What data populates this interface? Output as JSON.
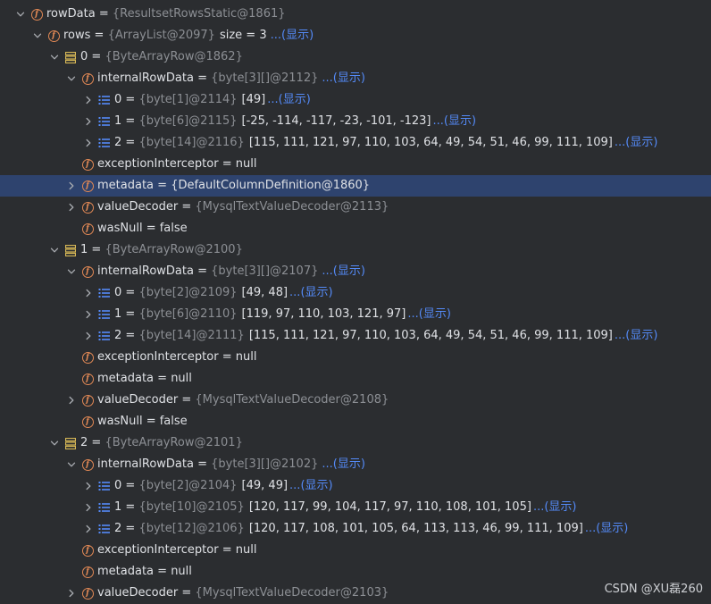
{
  "link_label": "...(显示)",
  "watermark": "CSDN @XU磊260",
  "colors": {
    "background": "#2b2d30",
    "selection": "#2e436e",
    "field_icon": "#e08855",
    "array_icon": "#548af7",
    "row_icon": "#d6b756",
    "reference_text": "#8c8f94",
    "link": "#548af7"
  },
  "rows": [
    {
      "level": 0,
      "arrow": "expanded",
      "icon": "field-icon",
      "name": "rowData",
      "ref": "{ResultsetRowsStatic@1861}",
      "value": "",
      "extra": "",
      "link": false,
      "selected": false
    },
    {
      "level": 1,
      "arrow": "expanded",
      "icon": "field-icon",
      "name": "rows",
      "ref": "{ArrayList@2097}",
      "value": "",
      "extra": "size = 3",
      "link": true,
      "selected": false
    },
    {
      "level": 2,
      "arrow": "expanded",
      "icon": "row-icon",
      "name": "0",
      "ref": "{ByteArrayRow@1862}",
      "value": "",
      "extra": "",
      "link": false,
      "selected": false
    },
    {
      "level": 3,
      "arrow": "expanded",
      "icon": "field-icon",
      "name": "internalRowData",
      "ref": "{byte[3][]@2112}",
      "value": "",
      "extra": "",
      "link": true,
      "selected": false
    },
    {
      "level": 4,
      "arrow": "collapsed",
      "icon": "array-icon",
      "name": "0",
      "ref": "{byte[1]@2114}",
      "value": "[49]",
      "extra": "",
      "link": true,
      "selected": false
    },
    {
      "level": 4,
      "arrow": "collapsed",
      "icon": "array-icon",
      "name": "1",
      "ref": "{byte[6]@2115}",
      "value": "[-25, -114, -117, -23, -101, -123]",
      "extra": "",
      "link": true,
      "selected": false
    },
    {
      "level": 4,
      "arrow": "collapsed",
      "icon": "array-icon",
      "name": "2",
      "ref": "{byte[14]@2116}",
      "value": "[115, 111, 121, 97, 110, 103, 64, 49, 54, 51, 46, 99, 111, 109]",
      "extra": "",
      "link": true,
      "selected": false
    },
    {
      "level": 3,
      "arrow": "none",
      "icon": "field-icon",
      "name": "exceptionInterceptor",
      "ref": "",
      "value": "null",
      "extra": "",
      "link": false,
      "selected": false
    },
    {
      "level": 3,
      "arrow": "collapsed",
      "icon": "field-icon",
      "name": "metadata",
      "ref": "",
      "value": "{DefaultColumnDefinition@1860}",
      "extra": "",
      "link": false,
      "selected": true
    },
    {
      "level": 3,
      "arrow": "collapsed",
      "icon": "field-icon",
      "name": "valueDecoder",
      "ref": "{MysqlTextValueDecoder@2113}",
      "value": "",
      "extra": "",
      "link": false,
      "selected": false
    },
    {
      "level": 3,
      "arrow": "none",
      "icon": "field-icon",
      "name": "wasNull",
      "ref": "",
      "value": "false",
      "extra": "",
      "link": false,
      "selected": false
    },
    {
      "level": 2,
      "arrow": "expanded",
      "icon": "row-icon",
      "name": "1",
      "ref": "{ByteArrayRow@2100}",
      "value": "",
      "extra": "",
      "link": false,
      "selected": false
    },
    {
      "level": 3,
      "arrow": "expanded",
      "icon": "field-icon",
      "name": "internalRowData",
      "ref": "{byte[3][]@2107}",
      "value": "",
      "extra": "",
      "link": true,
      "selected": false
    },
    {
      "level": 4,
      "arrow": "collapsed",
      "icon": "array-icon",
      "name": "0",
      "ref": "{byte[2]@2109}",
      "value": "[49, 48]",
      "extra": "",
      "link": true,
      "selected": false
    },
    {
      "level": 4,
      "arrow": "collapsed",
      "icon": "array-icon",
      "name": "1",
      "ref": "{byte[6]@2110}",
      "value": "[119, 97, 110, 103, 121, 97]",
      "extra": "",
      "link": true,
      "selected": false
    },
    {
      "level": 4,
      "arrow": "collapsed",
      "icon": "array-icon",
      "name": "2",
      "ref": "{byte[14]@2111}",
      "value": "[115, 111, 121, 97, 110, 103, 64, 49, 54, 51, 46, 99, 111, 109]",
      "extra": "",
      "link": true,
      "selected": false
    },
    {
      "level": 3,
      "arrow": "none",
      "icon": "field-icon",
      "name": "exceptionInterceptor",
      "ref": "",
      "value": "null",
      "extra": "",
      "link": false,
      "selected": false
    },
    {
      "level": 3,
      "arrow": "none",
      "icon": "field-icon",
      "name": "metadata",
      "ref": "",
      "value": "null",
      "extra": "",
      "link": false,
      "selected": false
    },
    {
      "level": 3,
      "arrow": "collapsed",
      "icon": "field-icon",
      "name": "valueDecoder",
      "ref": "{MysqlTextValueDecoder@2108}",
      "value": "",
      "extra": "",
      "link": false,
      "selected": false
    },
    {
      "level": 3,
      "arrow": "none",
      "icon": "field-icon",
      "name": "wasNull",
      "ref": "",
      "value": "false",
      "extra": "",
      "link": false,
      "selected": false
    },
    {
      "level": 2,
      "arrow": "expanded",
      "icon": "row-icon",
      "name": "2",
      "ref": "{ByteArrayRow@2101}",
      "value": "",
      "extra": "",
      "link": false,
      "selected": false
    },
    {
      "level": 3,
      "arrow": "expanded",
      "icon": "field-icon",
      "name": "internalRowData",
      "ref": "{byte[3][]@2102}",
      "value": "",
      "extra": "",
      "link": true,
      "selected": false
    },
    {
      "level": 4,
      "arrow": "collapsed",
      "icon": "array-icon",
      "name": "0",
      "ref": "{byte[2]@2104}",
      "value": "[49, 49]",
      "extra": "",
      "link": true,
      "selected": false
    },
    {
      "level": 4,
      "arrow": "collapsed",
      "icon": "array-icon",
      "name": "1",
      "ref": "{byte[10]@2105}",
      "value": "[120, 117, 99, 104, 117, 97, 110, 108, 101, 105]",
      "extra": "",
      "link": true,
      "selected": false
    },
    {
      "level": 4,
      "arrow": "collapsed",
      "icon": "array-icon",
      "name": "2",
      "ref": "{byte[12]@2106}",
      "value": "[120, 117, 108, 101, 105, 64, 113, 113, 46, 99, 111, 109]",
      "extra": "",
      "link": true,
      "selected": false
    },
    {
      "level": 3,
      "arrow": "none",
      "icon": "field-icon",
      "name": "exceptionInterceptor",
      "ref": "",
      "value": "null",
      "extra": "",
      "link": false,
      "selected": false
    },
    {
      "level": 3,
      "arrow": "none",
      "icon": "field-icon",
      "name": "metadata",
      "ref": "",
      "value": "null",
      "extra": "",
      "link": false,
      "selected": false
    },
    {
      "level": 3,
      "arrow": "collapsed",
      "icon": "field-icon",
      "name": "valueDecoder",
      "ref": "{MysqlTextValueDecoder@2103}",
      "value": "",
      "extra": "",
      "link": false,
      "selected": false
    }
  ]
}
